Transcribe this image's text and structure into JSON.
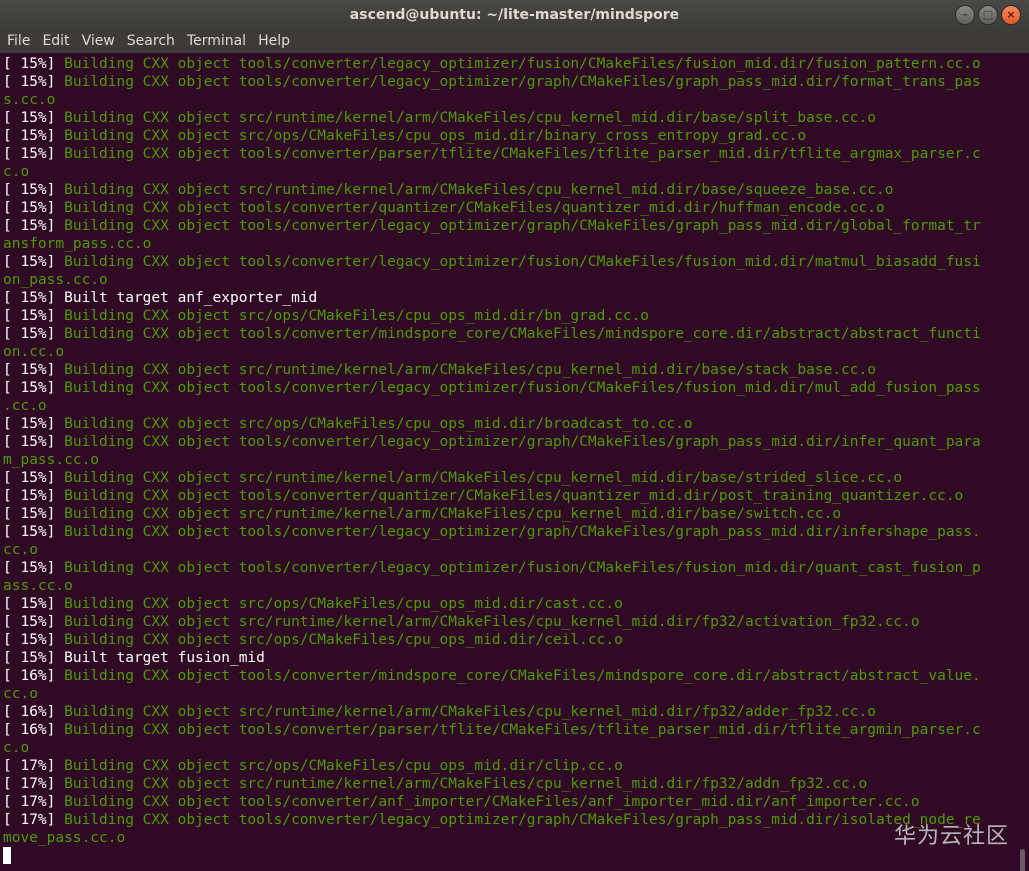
{
  "window": {
    "title": "ascend@ubuntu: ~/lite-master/mindspore",
    "buttons": [
      "–",
      "□",
      "×"
    ]
  },
  "menu": [
    "File",
    "Edit",
    "View",
    "Search",
    "Terminal",
    "Help"
  ],
  "terminal": {
    "lines": [
      {
        "p": "[ 15%]",
        "t": "Building CXX object tools/converter/legacy_optimizer/fusion/CMakeFiles/fusion_mid.dir/fusion_pattern.cc.o",
        "g": true
      },
      {
        "p": "[ 15%]",
        "t": "Building CXX object tools/converter/legacy_optimizer/graph/CMakeFiles/graph_pass_mid.dir/format_trans_pas",
        "g": true
      },
      {
        "p": "",
        "t": "s.cc.o",
        "g": true
      },
      {
        "p": "[ 15%]",
        "t": "Building CXX object src/runtime/kernel/arm/CMakeFiles/cpu_kernel_mid.dir/base/split_base.cc.o",
        "g": true
      },
      {
        "p": "[ 15%]",
        "t": "Building CXX object src/ops/CMakeFiles/cpu_ops_mid.dir/binary_cross_entropy_grad.cc.o",
        "g": true
      },
      {
        "p": "[ 15%]",
        "t": "Building CXX object tools/converter/parser/tflite/CMakeFiles/tflite_parser_mid.dir/tflite_argmax_parser.c",
        "g": true
      },
      {
        "p": "",
        "t": "c.o",
        "g": true
      },
      {
        "p": "[ 15%]",
        "t": "Building CXX object src/runtime/kernel/arm/CMakeFiles/cpu_kernel_mid.dir/base/squeeze_base.cc.o",
        "g": true
      },
      {
        "p": "[ 15%]",
        "t": "Building CXX object tools/converter/quantizer/CMakeFiles/quantizer_mid.dir/huffman_encode.cc.o",
        "g": true
      },
      {
        "p": "[ 15%]",
        "t": "Building CXX object tools/converter/legacy_optimizer/graph/CMakeFiles/graph_pass_mid.dir/global_format_tr",
        "g": true
      },
      {
        "p": "",
        "t": "ansform_pass.cc.o",
        "g": true
      },
      {
        "p": "[ 15%]",
        "t": "Building CXX object tools/converter/legacy_optimizer/fusion/CMakeFiles/fusion_mid.dir/matmul_biasadd_fusi",
        "g": true
      },
      {
        "p": "",
        "t": "on_pass.cc.o",
        "g": true
      },
      {
        "p": "[ 15%]",
        "t": "Built target anf_exporter_mid",
        "g": false
      },
      {
        "p": "[ 15%]",
        "t": "Building CXX object src/ops/CMakeFiles/cpu_ops_mid.dir/bn_grad.cc.o",
        "g": true
      },
      {
        "p": "[ 15%]",
        "t": "Building CXX object tools/converter/mindspore_core/CMakeFiles/mindspore_core.dir/abstract/abstract_functi",
        "g": true
      },
      {
        "p": "",
        "t": "on.cc.o",
        "g": true
      },
      {
        "p": "[ 15%]",
        "t": "Building CXX object src/runtime/kernel/arm/CMakeFiles/cpu_kernel_mid.dir/base/stack_base.cc.o",
        "g": true
      },
      {
        "p": "[ 15%]",
        "t": "Building CXX object tools/converter/legacy_optimizer/fusion/CMakeFiles/fusion_mid.dir/mul_add_fusion_pass",
        "g": true
      },
      {
        "p": "",
        "t": ".cc.o",
        "g": true
      },
      {
        "p": "[ 15%]",
        "t": "Building CXX object src/ops/CMakeFiles/cpu_ops_mid.dir/broadcast_to.cc.o",
        "g": true
      },
      {
        "p": "[ 15%]",
        "t": "Building CXX object tools/converter/legacy_optimizer/graph/CMakeFiles/graph_pass_mid.dir/infer_quant_para",
        "g": true
      },
      {
        "p": "",
        "t": "m_pass.cc.o",
        "g": true
      },
      {
        "p": "[ 15%]",
        "t": "Building CXX object src/runtime/kernel/arm/CMakeFiles/cpu_kernel_mid.dir/base/strided_slice.cc.o",
        "g": true
      },
      {
        "p": "[ 15%]",
        "t": "Building CXX object tools/converter/quantizer/CMakeFiles/quantizer_mid.dir/post_training_quantizer.cc.o",
        "g": true
      },
      {
        "p": "[ 15%]",
        "t": "Building CXX object src/runtime/kernel/arm/CMakeFiles/cpu_kernel_mid.dir/base/switch.cc.o",
        "g": true
      },
      {
        "p": "[ 15%]",
        "t": "Building CXX object tools/converter/legacy_optimizer/graph/CMakeFiles/graph_pass_mid.dir/infershape_pass.",
        "g": true
      },
      {
        "p": "",
        "t": "cc.o",
        "g": true
      },
      {
        "p": "[ 15%]",
        "t": "Building CXX object tools/converter/legacy_optimizer/fusion/CMakeFiles/fusion_mid.dir/quant_cast_fusion_p",
        "g": true
      },
      {
        "p": "",
        "t": "ass.cc.o",
        "g": true
      },
      {
        "p": "[ 15%]",
        "t": "Building CXX object src/ops/CMakeFiles/cpu_ops_mid.dir/cast.cc.o",
        "g": true
      },
      {
        "p": "[ 15%]",
        "t": "Building CXX object src/runtime/kernel/arm/CMakeFiles/cpu_kernel_mid.dir/fp32/activation_fp32.cc.o",
        "g": true
      },
      {
        "p": "[ 15%]",
        "t": "Building CXX object src/ops/CMakeFiles/cpu_ops_mid.dir/ceil.cc.o",
        "g": true
      },
      {
        "p": "[ 15%]",
        "t": "Built target fusion_mid",
        "g": false
      },
      {
        "p": "[ 16%]",
        "t": "Building CXX object tools/converter/mindspore_core/CMakeFiles/mindspore_core.dir/abstract/abstract_value.",
        "g": true
      },
      {
        "p": "",
        "t": "cc.o",
        "g": true
      },
      {
        "p": "[ 16%]",
        "t": "Building CXX object src/runtime/kernel/arm/CMakeFiles/cpu_kernel_mid.dir/fp32/adder_fp32.cc.o",
        "g": true
      },
      {
        "p": "[ 16%]",
        "t": "Building CXX object tools/converter/parser/tflite/CMakeFiles/tflite_parser_mid.dir/tflite_argmin_parser.c",
        "g": true
      },
      {
        "p": "",
        "t": "c.o",
        "g": true
      },
      {
        "p": "[ 17%]",
        "t": "Building CXX object src/ops/CMakeFiles/cpu_ops_mid.dir/clip.cc.o",
        "g": true
      },
      {
        "p": "[ 17%]",
        "t": "Building CXX object src/runtime/kernel/arm/CMakeFiles/cpu_kernel_mid.dir/fp32/addn_fp32.cc.o",
        "g": true
      },
      {
        "p": "[ 17%]",
        "t": "Building CXX object tools/converter/anf_importer/CMakeFiles/anf_importer_mid.dir/anf_importer.cc.o",
        "g": true
      },
      {
        "p": "[ 17%]",
        "t": "Building CXX object tools/converter/legacy_optimizer/graph/CMakeFiles/graph_pass_mid.dir/isolated_node_re",
        "g": true
      },
      {
        "p": "",
        "t": "move_pass.cc.o",
        "g": true
      }
    ]
  },
  "watermark": "华为云社区"
}
